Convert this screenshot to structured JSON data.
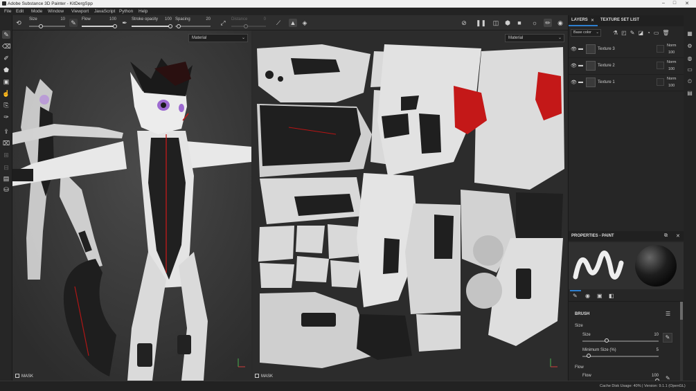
{
  "titlebar": {
    "title": "Adobe Substance 3D Painter - KitDergSpp",
    "min": "–",
    "max": "□",
    "close": "✕"
  },
  "menu": [
    "File",
    "Edit",
    "Mode",
    "Window",
    "Viewport",
    "JavaScript",
    "Python",
    "Help"
  ],
  "toolbar": {
    "size_label": "Size",
    "size_value": "10",
    "flow_label": "Flow",
    "flow_value": "100",
    "stroke_opacity_label": "Stroke opacity",
    "stroke_opacity_value": "100",
    "spacing_label": "Spacing",
    "spacing_value": "20",
    "distance_label": "Distance",
    "distance_value": "0"
  },
  "viewport3d": {
    "material_select": "Material",
    "mask_label": "MASK"
  },
  "viewport2d": {
    "material_select": "Material",
    "mask_label": "MASK"
  },
  "layers_panel": {
    "tab_layers": "LAYERS",
    "tab_texture_set_list": "TEXTURE SET LIST",
    "channel_select": "Base color",
    "layers": [
      {
        "name": "Texture 3",
        "blend": "Norm",
        "opacity": "100"
      },
      {
        "name": "Texture 2",
        "blend": "Norm",
        "opacity": "100"
      },
      {
        "name": "Texture 1",
        "blend": "Norm",
        "opacity": "100"
      }
    ]
  },
  "properties": {
    "title": "PROPERTIES - PAINT",
    "brush_section": "BRUSH",
    "size_group": "Size",
    "size_label": "Size",
    "size_value": "10",
    "min_size_label": "Minimum Size (%)",
    "min_size_value": "5",
    "flow_group": "Flow",
    "flow_label": "Flow",
    "flow_value": "100"
  },
  "status": {
    "cache": "Cache Disk Usage:   40%  |  Version: 9.1.1 (OpenGL)"
  },
  "colors": {
    "accent": "#2d7fd0",
    "uv_red": "#c41818",
    "background": "#2b2b2b"
  }
}
